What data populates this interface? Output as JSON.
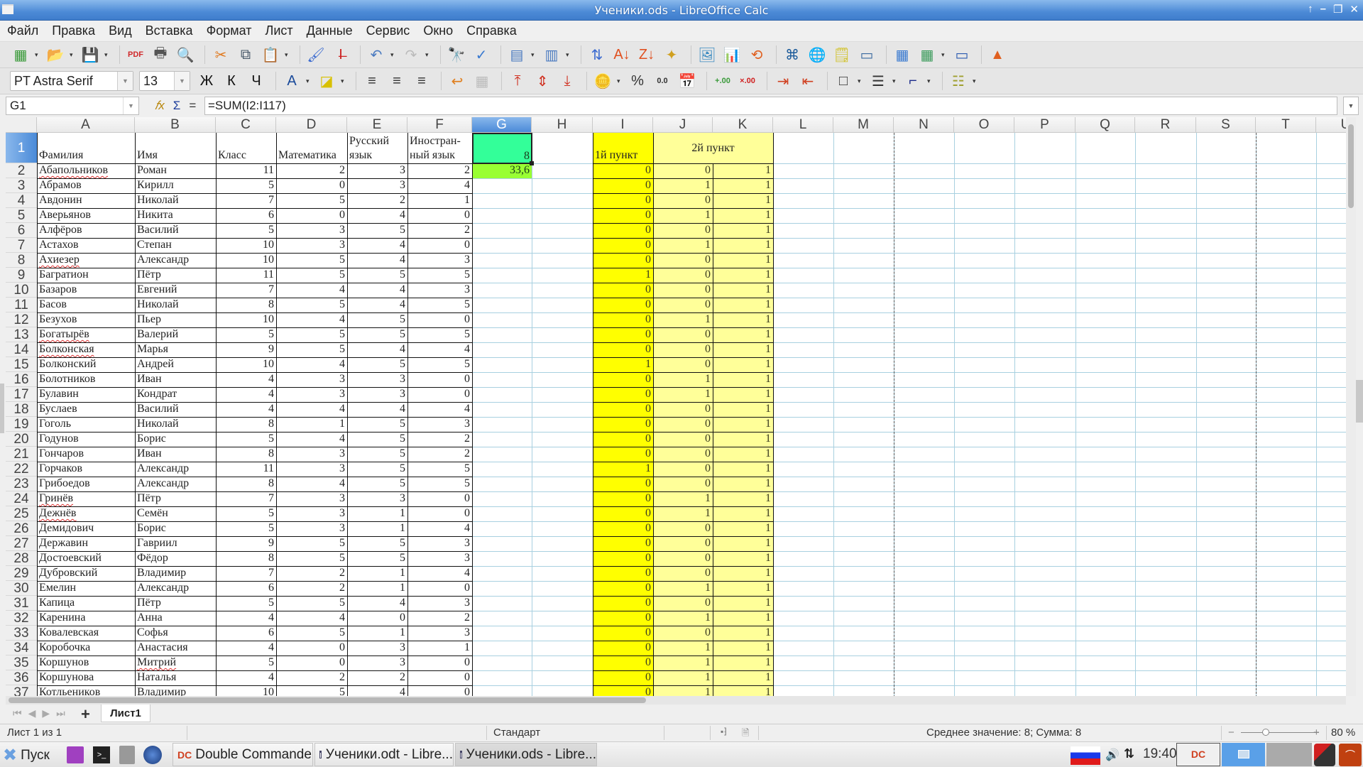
{
  "window": {
    "title": "Ученики.ods - LibreOffice Calc",
    "controls": [
      "↑",
      "–",
      "❐",
      "✕"
    ]
  },
  "menu": [
    "Файл",
    "Правка",
    "Вид",
    "Вставка",
    "Формат",
    "Лист",
    "Данные",
    "Сервис",
    "Окно",
    "Справка"
  ],
  "toolbar_standard": [
    {
      "name": "new-spreadsheet-icon",
      "glyph": "▦",
      "color": "#3a9a3a",
      "dropdown": true
    },
    {
      "name": "open-folder-icon",
      "glyph": "📂",
      "color": "#e8a020",
      "dropdown": true
    },
    {
      "name": "save-icon",
      "glyph": "💾",
      "color": "#3a6aa0",
      "dropdown": true
    },
    {
      "sep": true
    },
    {
      "name": "export-pdf-icon",
      "glyph": "PDF",
      "color": "#d0282a"
    },
    {
      "name": "print-icon",
      "glyph": "🖶",
      "color": "#555"
    },
    {
      "name": "print-preview-icon",
      "glyph": "🔍",
      "color": "#666"
    },
    {
      "sep": true
    },
    {
      "name": "cut-icon",
      "glyph": "✂",
      "color": "#e07a20"
    },
    {
      "name": "copy-icon",
      "glyph": "⧉",
      "color": "#456"
    },
    {
      "name": "paste-icon",
      "glyph": "📋",
      "color": "#a07030",
      "dropdown": true
    },
    {
      "sep": true
    },
    {
      "name": "clone-formatting-icon",
      "glyph": "🖌",
      "color": "#3a6ad0"
    },
    {
      "name": "clear-formatting-icon",
      "glyph": "I̶",
      "color": "#c22"
    },
    {
      "sep": true
    },
    {
      "name": "undo-icon",
      "glyph": "↶",
      "color": "#4a7ac0",
      "dropdown": true
    },
    {
      "name": "redo-icon",
      "glyph": "↷",
      "color": "#bbb",
      "dropdown": true
    },
    {
      "sep": true
    },
    {
      "name": "find-replace-icon",
      "glyph": "🔭",
      "color": "#222"
    },
    {
      "name": "spelling-icon",
      "glyph": "✓",
      "color": "#3a7ad0"
    },
    {
      "sep": true
    },
    {
      "name": "row-icon",
      "glyph": "▤",
      "color": "#4a7ac0",
      "dropdown": true
    },
    {
      "name": "column-icon",
      "glyph": "▥",
      "color": "#4a7ac0",
      "dropdown": true
    },
    {
      "sep": true
    },
    {
      "name": "sort-icon",
      "glyph": "⇅",
      "color": "#3a6ad0"
    },
    {
      "name": "sort-ascending-icon",
      "glyph": "A↓",
      "color": "#e05020"
    },
    {
      "name": "sort-descending-icon",
      "glyph": "Z↓",
      "color": "#e05020"
    },
    {
      "name": "autofilter-icon",
      "glyph": "✦",
      "color": "#d0a020"
    },
    {
      "sep": true
    },
    {
      "name": "insert-image-icon",
      "glyph": "🖼",
      "color": "#3a8ac0"
    },
    {
      "name": "insert-chart-icon",
      "glyph": "📊",
      "color": "#e0a020"
    },
    {
      "name": "pivot-table-icon",
      "glyph": "⟲",
      "color": "#e06020"
    },
    {
      "sep": true
    },
    {
      "name": "special-character-icon",
      "glyph": "⌘",
      "color": "#1a5a9a"
    },
    {
      "name": "hyperlink-icon",
      "glyph": "🌐",
      "color": "#3a8a3a"
    },
    {
      "name": "comment-icon",
      "glyph": "🗒",
      "color": "#d0c020"
    },
    {
      "name": "headers-footers-icon",
      "glyph": "▭",
      "color": "#3a6aa0"
    },
    {
      "sep": true
    },
    {
      "name": "define-print-area-icon",
      "glyph": "▦",
      "color": "#3a7ad0"
    },
    {
      "name": "freeze-rows-columns-icon",
      "glyph": "▦",
      "color": "#3a9a5a",
      "dropdown": true
    },
    {
      "name": "split-window-icon",
      "glyph": "▭",
      "color": "#2a5ab0"
    },
    {
      "sep": true
    },
    {
      "name": "shapes-icon",
      "glyph": "▲",
      "color": "#e06020"
    }
  ],
  "toolbar_formatting": {
    "font_name": "PT Astra Serif",
    "font_size": "13",
    "buttons": [
      {
        "name": "bold-icon",
        "glyph": "Ж",
        "color": "#111"
      },
      {
        "name": "italic-icon",
        "glyph": "К",
        "color": "#111"
      },
      {
        "name": "underline-icon",
        "glyph": "Ч",
        "color": "#111"
      },
      {
        "sep": true
      },
      {
        "name": "font-color-icon",
        "glyph": "A",
        "color": "#1a4a9a",
        "dropdown": true
      },
      {
        "name": "highlight-color-icon",
        "glyph": "◪",
        "color": "#d8c000",
        "dropdown": true
      },
      {
        "sep": true
      },
      {
        "name": "align-left-icon",
        "glyph": "≡",
        "color": "#333"
      },
      {
        "name": "align-center-icon",
        "glyph": "≡",
        "color": "#333"
      },
      {
        "name": "align-right-icon",
        "glyph": "≡",
        "color": "#333"
      },
      {
        "sep": true
      },
      {
        "name": "wrap-text-icon",
        "glyph": "↩",
        "color": "#e08020"
      },
      {
        "name": "merge-cells-icon",
        "glyph": "▦",
        "color": "#bbb"
      },
      {
        "sep": true
      },
      {
        "name": "align-top-icon",
        "glyph": "⤒",
        "color": "#d03020"
      },
      {
        "name": "align-middle-icon",
        "glyph": "⇕",
        "color": "#d03020"
      },
      {
        "name": "align-bottom-icon",
        "glyph": "⤓",
        "color": "#d03020"
      },
      {
        "sep": true
      },
      {
        "name": "currency-format-icon",
        "glyph": "🪙",
        "color": "#d0a020",
        "dropdown": true
      },
      {
        "name": "percent-format-icon",
        "glyph": "%",
        "color": "#333"
      },
      {
        "name": "number-format-icon",
        "glyph": "0.0",
        "color": "#333"
      },
      {
        "name": "date-format-icon",
        "glyph": "📅",
        "color": "#3a6aa0"
      },
      {
        "sep": true
      },
      {
        "name": "add-decimal-icon",
        "glyph": "+.00",
        "color": "#3a9a3a"
      },
      {
        "name": "delete-decimal-icon",
        "glyph": "×.00",
        "color": "#d02020"
      },
      {
        "sep": true
      },
      {
        "name": "increase-indent-icon",
        "glyph": "⇥",
        "color": "#d04020"
      },
      {
        "name": "decrease-indent-icon",
        "glyph": "⇤",
        "color": "#d04020"
      },
      {
        "sep": true
      },
      {
        "name": "borders-icon",
        "glyph": "□",
        "color": "#333",
        "dropdown": true
      },
      {
        "name": "border-style-icon",
        "glyph": "☰",
        "color": "#333",
        "dropdown": true
      },
      {
        "name": "border-color-icon",
        "glyph": "⌐",
        "color": "#1a2a8a",
        "dropdown": true
      },
      {
        "sep": true
      },
      {
        "name": "conditional-format-icon",
        "glyph": "☷",
        "color": "#a0a030",
        "dropdown": true
      }
    ]
  },
  "formula_bar": {
    "cell_ref": "G1",
    "fx": "𝑓x",
    "sigma": "Σ",
    "equals": "=",
    "formula": "=SUM(I2:I117)"
  },
  "columns": [
    "A",
    "B",
    "C",
    "D",
    "E",
    "F",
    "G",
    "H",
    "I",
    "J",
    "K",
    "L",
    "M",
    "N",
    "O",
    "P",
    "Q",
    "R",
    "S",
    "T",
    "U"
  ],
  "selected_column": "G",
  "header_row": {
    "A": "Фамилия",
    "B": "Имя",
    "C": "Класс",
    "D": "Математика",
    "E": "Русский язык",
    "F": "Иностран-ный язык",
    "G": "8",
    "I": "1й пункт",
    "JK": "2й пункт"
  },
  "g2_value": "33,6",
  "colors": {
    "g1": "#33ff99",
    "g2": "#99ff33",
    "col_i": "#ffff00",
    "col_jk": "#ffff99",
    "selection": "#4a8ad8"
  },
  "rows": [
    {
      "n": 2,
      "last": "Абапольников",
      "first": "Роман",
      "cls": 11,
      "math": 2,
      "rus": 3,
      "foreign": 2,
      "i": 0,
      "j": 0,
      "k": 1,
      "spell": true
    },
    {
      "n": 3,
      "last": "Абрамов",
      "first": "Кирилл",
      "cls": 5,
      "math": 0,
      "rus": 3,
      "foreign": 4,
      "i": 0,
      "j": 1,
      "k": 1
    },
    {
      "n": 4,
      "last": "Авдонин",
      "first": "Николай",
      "cls": 7,
      "math": 5,
      "rus": 2,
      "foreign": 1,
      "i": 0,
      "j": 0,
      "k": 1
    },
    {
      "n": 5,
      "last": "Аверьянов",
      "first": "Никита",
      "cls": 6,
      "math": 0,
      "rus": 4,
      "foreign": 0,
      "i": 0,
      "j": 1,
      "k": 1
    },
    {
      "n": 6,
      "last": "Алфёров",
      "first": "Василий",
      "cls": 5,
      "math": 3,
      "rus": 5,
      "foreign": 2,
      "i": 0,
      "j": 0,
      "k": 1
    },
    {
      "n": 7,
      "last": "Астахов",
      "first": "Степан",
      "cls": 10,
      "math": 3,
      "rus": 4,
      "foreign": 0,
      "i": 0,
      "j": 1,
      "k": 1
    },
    {
      "n": 8,
      "last": "Ахиезер",
      "first": "Александр",
      "cls": 10,
      "math": 5,
      "rus": 4,
      "foreign": 3,
      "i": 0,
      "j": 0,
      "k": 1,
      "spell": true
    },
    {
      "n": 9,
      "last": "Багратион",
      "first": "Пётр",
      "cls": 11,
      "math": 5,
      "rus": 5,
      "foreign": 5,
      "i": 1,
      "j": 0,
      "k": 1
    },
    {
      "n": 10,
      "last": "Базаров",
      "first": "Евгений",
      "cls": 7,
      "math": 4,
      "rus": 4,
      "foreign": 3,
      "i": 0,
      "j": 0,
      "k": 1
    },
    {
      "n": 11,
      "last": "Басов",
      "first": "Николай",
      "cls": 8,
      "math": 5,
      "rus": 4,
      "foreign": 5,
      "i": 0,
      "j": 0,
      "k": 1
    },
    {
      "n": 12,
      "last": "Безухов",
      "first": "Пьер",
      "cls": 10,
      "math": 4,
      "rus": 5,
      "foreign": 0,
      "i": 0,
      "j": 1,
      "k": 1
    },
    {
      "n": 13,
      "last": "Богатырёв",
      "first": "Валерий",
      "cls": 5,
      "math": 5,
      "rus": 5,
      "foreign": 5,
      "i": 0,
      "j": 0,
      "k": 1,
      "spell": true
    },
    {
      "n": 14,
      "last": "Болконская",
      "first": "Марья",
      "cls": 9,
      "math": 5,
      "rus": 4,
      "foreign": 4,
      "i": 0,
      "j": 0,
      "k": 1,
      "spell": true
    },
    {
      "n": 15,
      "last": "Болконский",
      "first": "Андрей",
      "cls": 10,
      "math": 4,
      "rus": 5,
      "foreign": 5,
      "i": 1,
      "j": 0,
      "k": 1
    },
    {
      "n": 16,
      "last": "Болотников",
      "first": "Иван",
      "cls": 4,
      "math": 3,
      "rus": 3,
      "foreign": 0,
      "i": 0,
      "j": 1,
      "k": 1
    },
    {
      "n": 17,
      "last": "Булавин",
      "first": "Кондрат",
      "cls": 4,
      "math": 3,
      "rus": 3,
      "foreign": 0,
      "i": 0,
      "j": 1,
      "k": 1
    },
    {
      "n": 18,
      "last": "Буслаев",
      "first": "Василий",
      "cls": 4,
      "math": 4,
      "rus": 4,
      "foreign": 4,
      "i": 0,
      "j": 0,
      "k": 1
    },
    {
      "n": 19,
      "last": "Гоголь",
      "first": "Николай",
      "cls": 8,
      "math": 1,
      "rus": 5,
      "foreign": 3,
      "i": 0,
      "j": 0,
      "k": 1
    },
    {
      "n": 20,
      "last": "Годунов",
      "first": "Борис",
      "cls": 5,
      "math": 4,
      "rus": 5,
      "foreign": 2,
      "i": 0,
      "j": 0,
      "k": 1
    },
    {
      "n": 21,
      "last": "Гончаров",
      "first": "Иван",
      "cls": 8,
      "math": 3,
      "rus": 5,
      "foreign": 2,
      "i": 0,
      "j": 0,
      "k": 1
    },
    {
      "n": 22,
      "last": "Горчаков",
      "first": "Александр",
      "cls": 11,
      "math": 3,
      "rus": 5,
      "foreign": 5,
      "i": 1,
      "j": 0,
      "k": 1
    },
    {
      "n": 23,
      "last": "Грибоедов",
      "first": "Александр",
      "cls": 8,
      "math": 4,
      "rus": 5,
      "foreign": 5,
      "i": 0,
      "j": 0,
      "k": 1
    },
    {
      "n": 24,
      "last": "Гринёв",
      "first": "Пётр",
      "cls": 7,
      "math": 3,
      "rus": 3,
      "foreign": 0,
      "i": 0,
      "j": 1,
      "k": 1,
      "spell": true
    },
    {
      "n": 25,
      "last": "Дежнёв",
      "first": "Семён",
      "cls": 5,
      "math": 3,
      "rus": 1,
      "foreign": 0,
      "i": 0,
      "j": 1,
      "k": 1,
      "spell": true
    },
    {
      "n": 26,
      "last": "Демидович",
      "first": "Борис",
      "cls": 5,
      "math": 3,
      "rus": 1,
      "foreign": 4,
      "i": 0,
      "j": 0,
      "k": 1
    },
    {
      "n": 27,
      "last": "Державин",
      "first": "Гавриил",
      "cls": 9,
      "math": 5,
      "rus": 5,
      "foreign": 3,
      "i": 0,
      "j": 0,
      "k": 1
    },
    {
      "n": 28,
      "last": "Достоевский",
      "first": "Фёдор",
      "cls": 8,
      "math": 5,
      "rus": 5,
      "foreign": 3,
      "i": 0,
      "j": 0,
      "k": 1
    },
    {
      "n": 29,
      "last": "Дубровский",
      "first": "Владимир",
      "cls": 7,
      "math": 2,
      "rus": 1,
      "foreign": 4,
      "i": 0,
      "j": 0,
      "k": 1
    },
    {
      "n": 30,
      "last": "Емелин",
      "first": "Александр",
      "cls": 6,
      "math": 2,
      "rus": 1,
      "foreign": 0,
      "i": 0,
      "j": 1,
      "k": 1
    },
    {
      "n": 31,
      "last": "Капица",
      "first": "Пётр",
      "cls": 5,
      "math": 5,
      "rus": 4,
      "foreign": 3,
      "i": 0,
      "j": 0,
      "k": 1
    },
    {
      "n": 32,
      "last": "Каренина",
      "first": "Анна",
      "cls": 4,
      "math": 4,
      "rus": 0,
      "foreign": 2,
      "i": 0,
      "j": 1,
      "k": 1
    },
    {
      "n": 33,
      "last": "Ковалевская",
      "first": "Софья",
      "cls": 6,
      "math": 5,
      "rus": 1,
      "foreign": 3,
      "i": 0,
      "j": 0,
      "k": 1
    },
    {
      "n": 34,
      "last": "Коробочка",
      "first": "Анастасия",
      "cls": 4,
      "math": 0,
      "rus": 3,
      "foreign": 1,
      "i": 0,
      "j": 1,
      "k": 1
    },
    {
      "n": 35,
      "last": "Коршунов",
      "first": "Митрий",
      "cls": 5,
      "math": 0,
      "rus": 3,
      "foreign": 0,
      "i": 0,
      "j": 1,
      "k": 1,
      "spell_first": true
    },
    {
      "n": 36,
      "last": "Коршунова",
      "first": " Наталья",
      "cls": 4,
      "math": 2,
      "rus": 2,
      "foreign": 0,
      "i": 0,
      "j": 1,
      "k": 1
    },
    {
      "n": 37,
      "last": "Котльеников",
      "first": "Владимир",
      "cls": 10,
      "math": 5,
      "rus": 4,
      "foreign": 0,
      "i": 0,
      "j": 1,
      "k": 1
    }
  ],
  "sheet_tabs": {
    "active": "Лист1",
    "add": "+"
  },
  "status_bar": {
    "sheet_info": "Лист 1 из 1",
    "page_style": "Стандарт",
    "selection_summary": "Среднее значение: 8; Сумма: 8",
    "zoom_minus": "−",
    "zoom_plus": "+",
    "zoom": "80 %"
  },
  "taskbar": {
    "start_label": "Пуск",
    "windows": [
      {
        "label": "Double Commander...",
        "active": false
      },
      {
        "label": "Ученики.odt - Libre...",
        "active": false
      },
      {
        "label": "Ученики.ods - Libre...",
        "active": true
      }
    ],
    "clock": "19:40"
  }
}
